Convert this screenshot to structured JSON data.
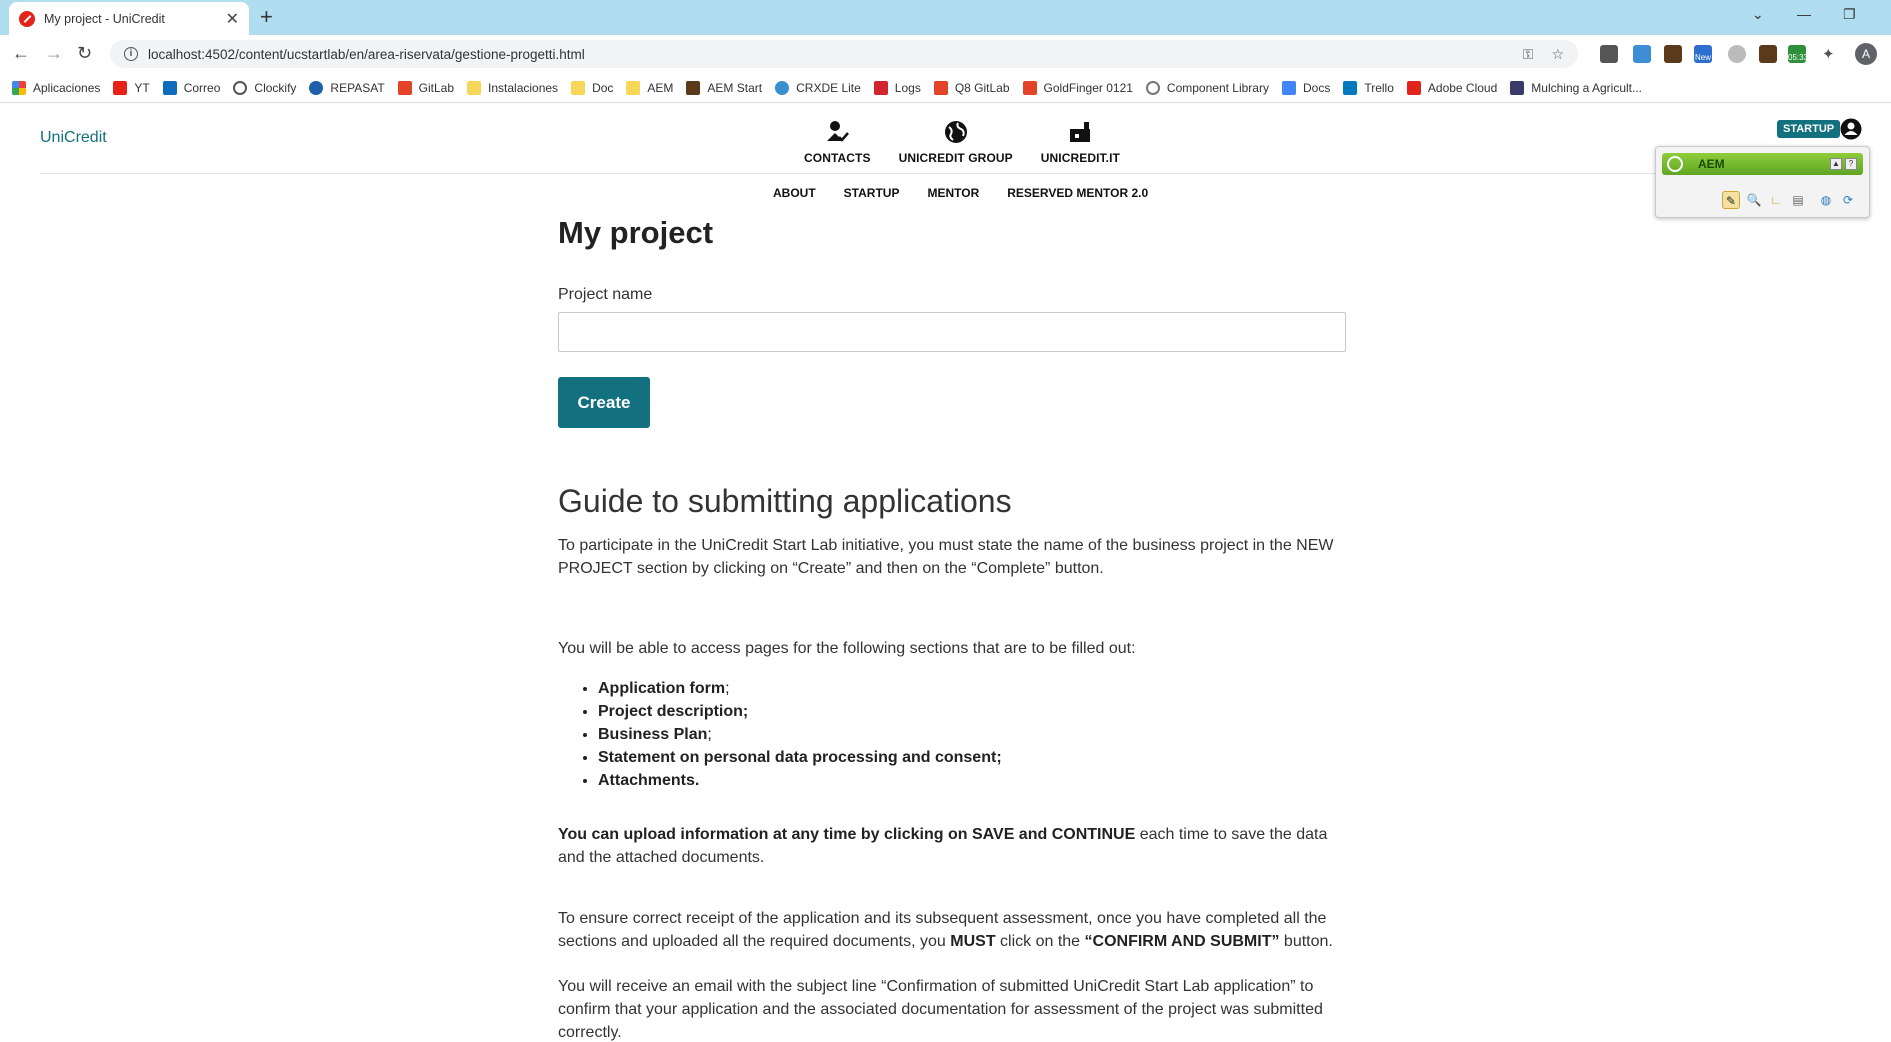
{
  "browser": {
    "tab_title": "My project - UniCredit",
    "url": "localhost:4502/content/ucstartlab/en/area-riservata/gestione-progetti.html",
    "bookmarks": [
      "Aplicaciones",
      "YT",
      "Correo",
      "Clockify",
      "REPASAT",
      "GitLab",
      "Instalaciones",
      "Doc",
      "AEM",
      "AEM Start",
      "CRXDE Lite",
      "Logs",
      "Q8 GitLab",
      "GoldFinger 0121",
      "Component Library",
      "Docs",
      "Trello",
      "Adobe Cloud",
      "Mulching a Agricult..."
    ],
    "extension_badges": {
      "new": "New",
      "timer": "05:33"
    },
    "profile_initial": "A"
  },
  "header": {
    "logo_alt": "UniCredit",
    "top_nav": [
      "CONTACTS",
      "UNICREDIT GROUP",
      "UNICREDIT.IT"
    ],
    "sub_nav": [
      "ABOUT",
      "STARTUP",
      "MENTOR",
      "RESERVED MENTOR 2.0"
    ],
    "badge": "STARTUP"
  },
  "aem_panel": {
    "title": "AEM"
  },
  "main": {
    "title": "My project",
    "project_name_label": "Project name",
    "project_name_value": "",
    "create_label": "Create",
    "guide_title": "Guide to submitting applications",
    "intro": "To participate in the UniCredit Start Lab initiative, you must state the name of the business project in the NEW PROJECT section by clicking on “Create” and then on the “Complete” button.",
    "sections_intro": "You will be able to access pages for the following sections that are to be filled out:",
    "sections": [
      "Application form",
      "Project description",
      "Business Plan",
      "Statement on personal data processing and consent",
      "Attachments"
    ],
    "upload_bold": "You can upload information at any time by clicking on SAVE and CONTINUE",
    "upload_rest": " each time to save the data and the attached documents.",
    "ensure_text": "To ensure correct receipt of the application and its subsequent assessment, once you have completed all the sections and uploaded all the required documents, you ",
    "must": "MUST",
    "click_on": " click on the ",
    "confirm": "“CONFIRM AND SUBMIT”",
    "button_word": " button.",
    "email_text": "You will receive an email with the subject line “Confirmation of submitted UniCredit Start Lab application” to confirm that your application and the associated documentation for assessment of the project was submitted correctly."
  }
}
